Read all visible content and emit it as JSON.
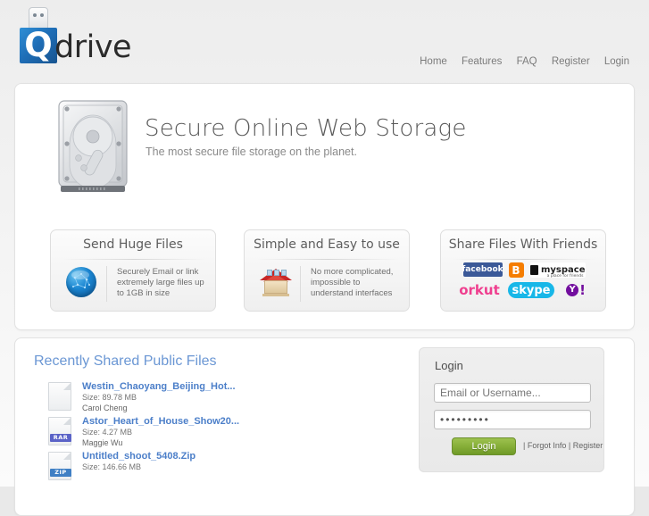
{
  "header": {
    "logo": {
      "mark": "Q",
      "word": "drive"
    },
    "nav": [
      {
        "label": "Home"
      },
      {
        "label": "Features"
      },
      {
        "label": "FAQ"
      },
      {
        "label": "Register"
      },
      {
        "label": "Login"
      }
    ]
  },
  "hero": {
    "icon": "hard-drive-icon",
    "title": "Secure Online Web Storage",
    "subtitle": "The most secure file storage on the planet."
  },
  "features": [
    {
      "title": "Send Huge Files",
      "icon": "globe-icon",
      "text": "Securely Email or link extremely large files up to 1GB in size"
    },
    {
      "title": "Simple and Easy to use",
      "icon": "house-icon",
      "text": "No more complicated, impossible to understand interfaces"
    },
    {
      "title": "Share Files With Friends",
      "icon": "social-logos",
      "socials": [
        {
          "name": "facebook",
          "label": "facebook"
        },
        {
          "name": "blogger",
          "label": "B"
        },
        {
          "name": "myspace",
          "label": "myspace",
          "tagline": "a place for friends"
        },
        {
          "name": "orkut",
          "label": "orkut"
        },
        {
          "name": "skype",
          "label": "skype"
        },
        {
          "name": "yahoo",
          "label": "Y",
          "suffix": "!"
        }
      ]
    }
  ],
  "recent": {
    "title": "Recently Shared Public Files",
    "files": [
      {
        "name": "Westin_Chaoyang_Beijing_Hot...",
        "size": "Size: 89.78 MB",
        "owner": "Carol Cheng",
        "type": ""
      },
      {
        "name": "Astor_Heart_of_House_Show20...",
        "size": "Size: 4.27 MB",
        "owner": "Maggie Wu",
        "type": "RAR"
      },
      {
        "name": "Untitled_shoot_5408.Zip",
        "size": "Size: 146.66 MB",
        "owner": "",
        "type": "ZIP"
      }
    ]
  },
  "login": {
    "title": "Login",
    "username_placeholder": "Email or Username...",
    "username_value": "",
    "password_value": "•••••••••",
    "button_label": "Login",
    "links": "| Forgot Info | Register",
    "forgot_label": "Forgot Info",
    "register_label": "Register"
  },
  "colors": {
    "link_blue": "#4c7fc9",
    "section_blue": "#6b97d4",
    "button_green": "#86ae38",
    "logo_blue": "#1f6fb8"
  }
}
